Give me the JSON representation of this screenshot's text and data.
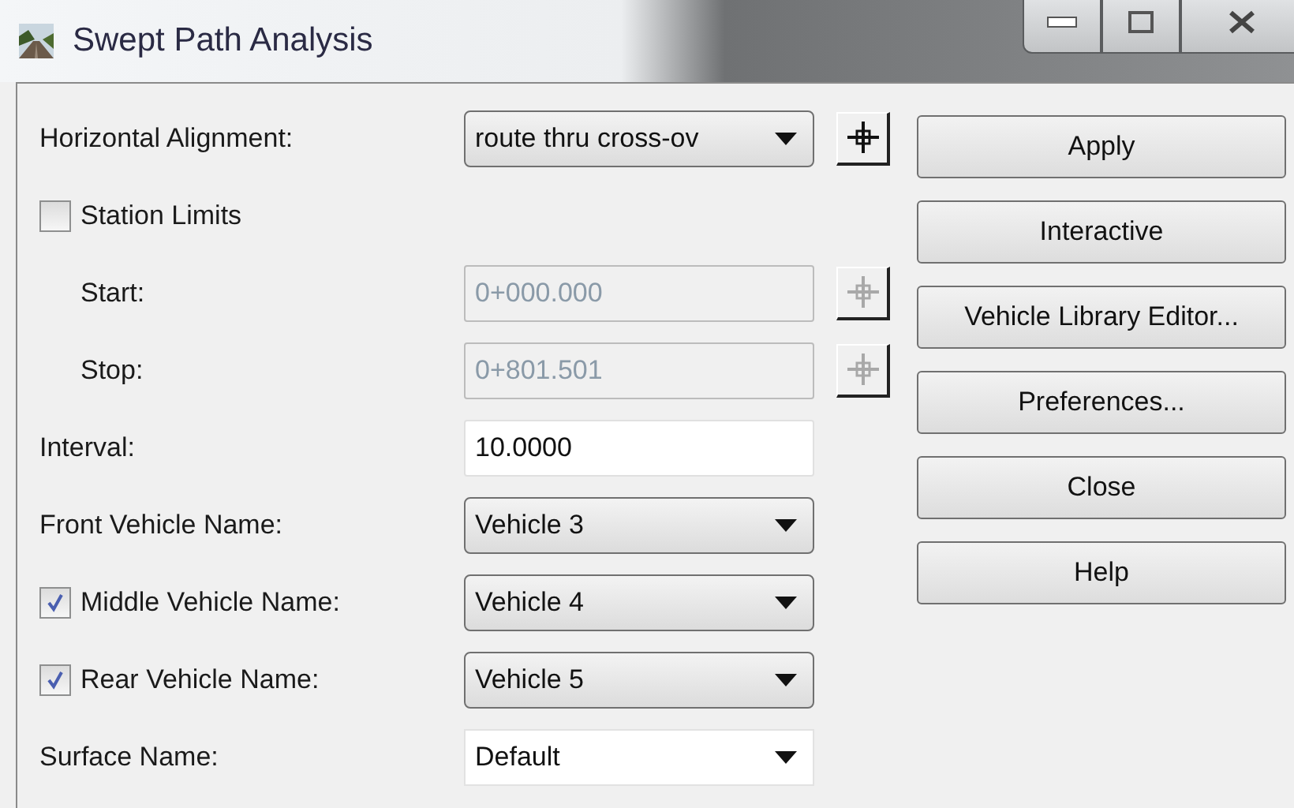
{
  "window": {
    "title": "Swept Path Analysis"
  },
  "rows": [
    {
      "kind": "dropdown",
      "label": "Horizontal Alignment:",
      "value": "route thru cross-ov",
      "pick": {
        "disabled": false
      }
    },
    {
      "kind": "checkbox",
      "label": "Station Limits",
      "checked": false,
      "children": [
        {
          "kind": "text_field",
          "label": "Start:",
          "value": "0+000.000",
          "disabled": true,
          "pick": {
            "disabled": true
          }
        },
        {
          "kind": "text_field",
          "label": "Stop:",
          "value": "0+801.501",
          "disabled": true,
          "pick": {
            "disabled": true
          }
        }
      ]
    },
    {
      "kind": "text_field",
      "label": "Interval:",
      "value": "10.0000",
      "disabled": false
    },
    {
      "kind": "dropdown",
      "label": "Front Vehicle Name:",
      "value": "Vehicle 3"
    },
    {
      "kind": "dropdown",
      "label": "Middle Vehicle Name:",
      "value": "Vehicle 4",
      "checked": true
    },
    {
      "kind": "dropdown",
      "label": "Rear Vehicle Name:",
      "value": "Vehicle 5",
      "checked": true
    },
    {
      "kind": "combo",
      "label": "Surface Name:",
      "value": "Default"
    }
  ],
  "buttons": [
    "Apply",
    "Interactive",
    "Vehicle Library Editor...",
    "Preferences...",
    "Close",
    "Help"
  ]
}
